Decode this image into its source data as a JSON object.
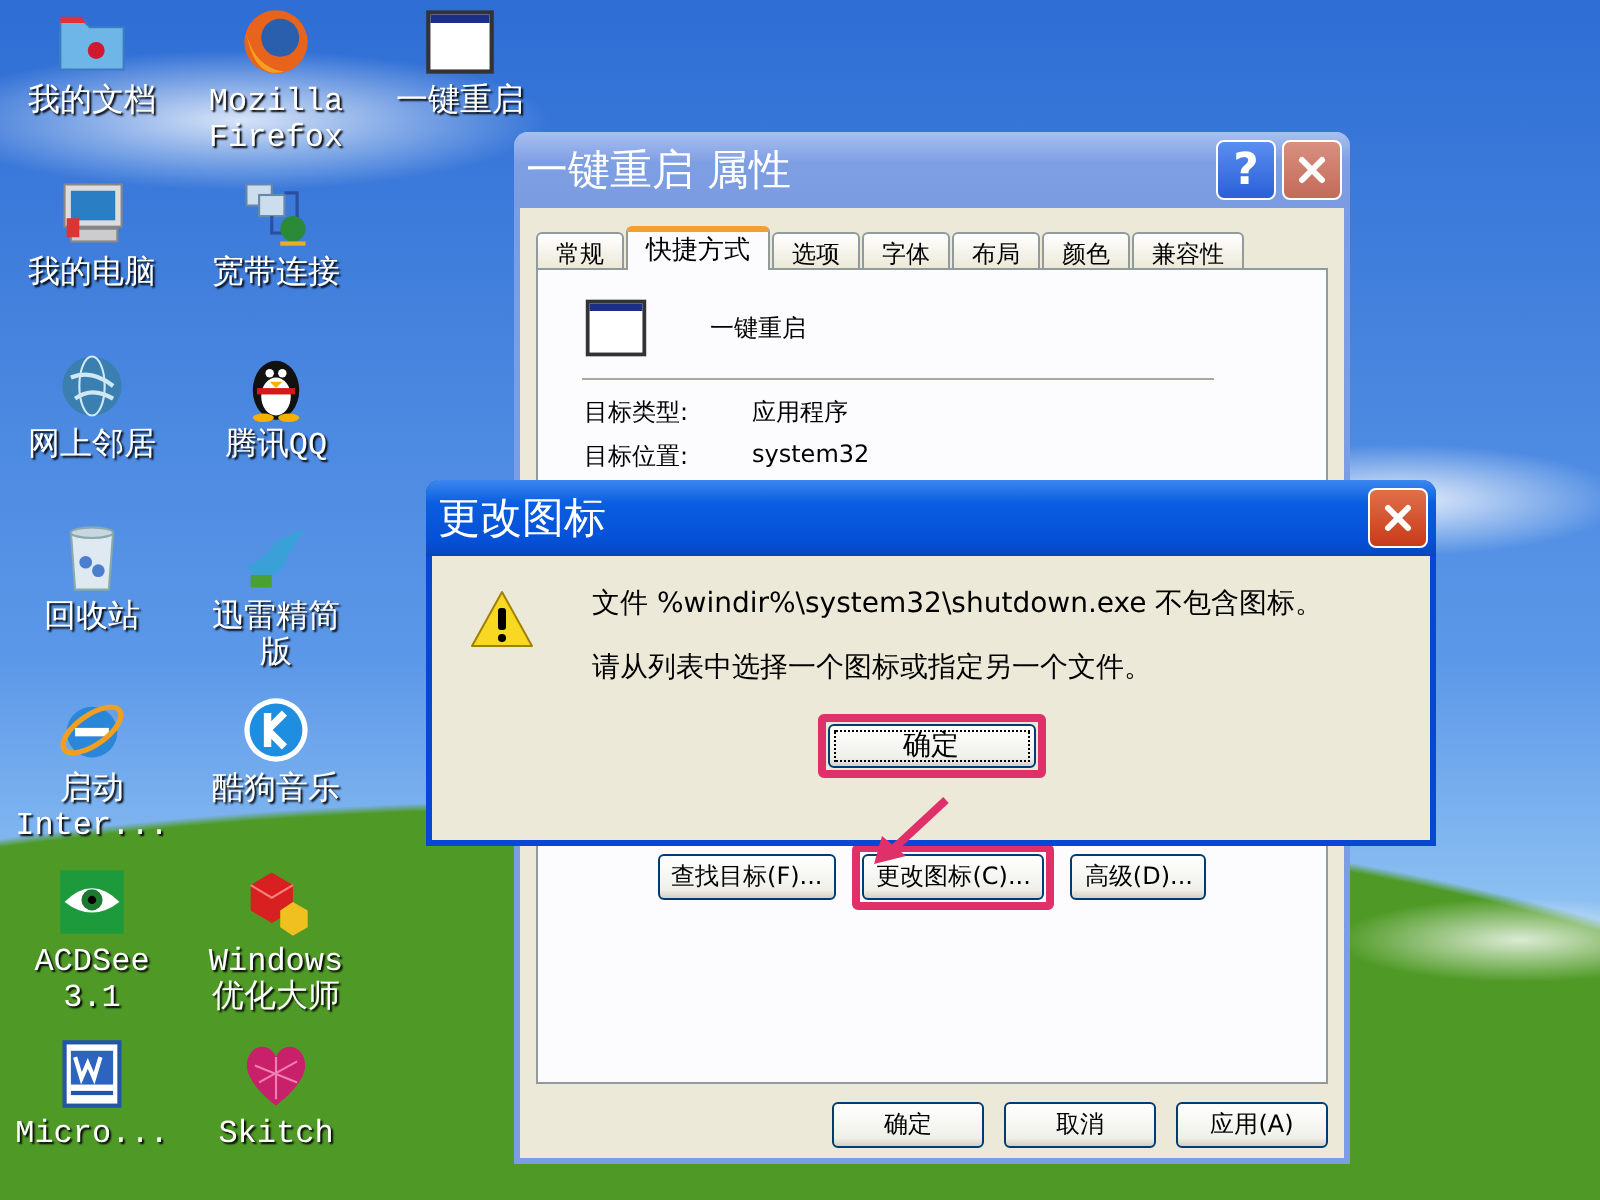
{
  "desktop": {
    "icons": [
      {
        "kind": "folder",
        "label": "我的文档"
      },
      {
        "kind": "computer",
        "label": "我的电脑"
      },
      {
        "kind": "network",
        "label": "网上邻居"
      },
      {
        "kind": "trash",
        "label": "回收站"
      },
      {
        "kind": "ie",
        "label": "启动 Inter..."
      },
      {
        "kind": "eye",
        "label": "ACDSee 3.1"
      },
      {
        "kind": "word",
        "label": "Micro..."
      },
      {
        "kind": "firefox",
        "label": "Mozilla Firefox"
      },
      {
        "kind": "broadband",
        "label": "宽带连接"
      },
      {
        "kind": "penguin",
        "label": "腾讯QQ"
      },
      {
        "kind": "bird",
        "label": "迅雷精简版"
      },
      {
        "kind": "kmusic",
        "label": "酷狗音乐"
      },
      {
        "kind": "cubes",
        "label": "Windows 优化大师"
      },
      {
        "kind": "heart",
        "label": "Skitch"
      },
      {
        "kind": "window",
        "label": "一键重启"
      }
    ]
  },
  "properties_window": {
    "title": "一键重启 属性",
    "active": false,
    "help_label": "?",
    "tabs": [
      {
        "label": "常规",
        "selected": false
      },
      {
        "label": "快捷方式",
        "selected": true
      },
      {
        "label": "选项",
        "selected": false
      },
      {
        "label": "字体",
        "selected": false
      },
      {
        "label": "布局",
        "selected": false
      },
      {
        "label": "颜色",
        "selected": false
      },
      {
        "label": "兼容性",
        "selected": false
      }
    ],
    "shortcut_name": "一键重启",
    "fields": [
      {
        "label": "目标类型:",
        "value": "应用程序"
      },
      {
        "label": "目标位置:",
        "value": "system32"
      }
    ],
    "buttons": [
      {
        "label": "查找目标(F)...",
        "highlighted": false
      },
      {
        "label": "更改图标(C)...",
        "highlighted": true
      },
      {
        "label": "高级(D)...",
        "highlighted": false
      }
    ],
    "footer_buttons": [
      {
        "label": "确定"
      },
      {
        "label": "取消"
      },
      {
        "label": "应用(A)"
      }
    ]
  },
  "alert": {
    "title": "更改图标",
    "active": true,
    "lines": [
      "文件 %windir%\\system32\\shutdown.exe 不包含图标。",
      "请从列表中选择一个图标或指定另一个文件。"
    ],
    "button": {
      "label": "确定",
      "highlighted": true,
      "focused": true
    }
  }
}
